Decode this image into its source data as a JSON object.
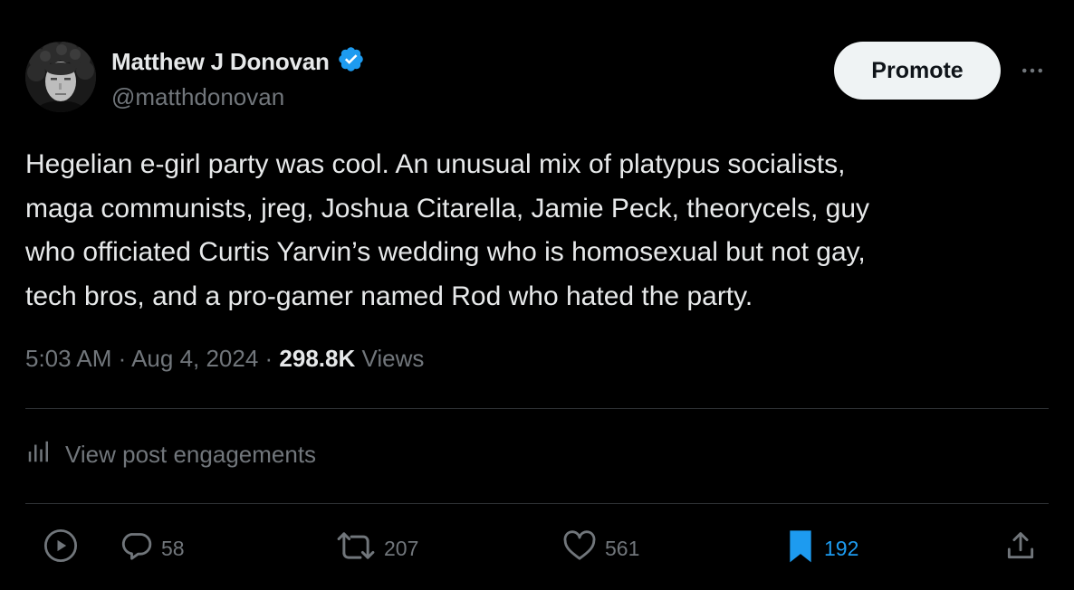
{
  "author": {
    "name": "Matthew J Donovan",
    "handle": "@matthdonovan",
    "verified": true,
    "verified_badge_color": "#1d9bf0"
  },
  "header": {
    "promote_label": "Promote",
    "more_icon": "more-horizontal-icon"
  },
  "post": {
    "lines": [
      "Hegelian e-girl party was cool. An unusual mix of platypus socialists,",
      "maga communists, jreg, Joshua Citarella, Jamie Peck, theorycels, guy",
      "who officiated Curtis Yarvin’s wedding who is homosexual but not gay,",
      "tech bros, and a pro-gamer named Rod who hated the party."
    ]
  },
  "meta": {
    "time": "5:03 AM",
    "separator": " · ",
    "date": "Aug 4, 2024",
    "views_count": "298.8K",
    "views_label": " Views"
  },
  "engagements": {
    "label": "View post engagements",
    "icon": "analytics-bars-icon"
  },
  "actions": {
    "replies": "58",
    "reposts": "207",
    "likes": "561",
    "bookmarks": "192",
    "bookmarked": true
  },
  "colors": {
    "background": "#000000",
    "text_primary": "#e7e9ea",
    "text_secondary": "#71767b",
    "accent": "#1d9bf0",
    "divider": "#2f3336"
  }
}
